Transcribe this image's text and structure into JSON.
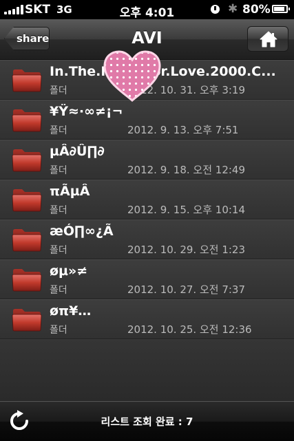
{
  "status_bar": {
    "carrier": "SKT",
    "network": "3G",
    "time": "오후 4:01",
    "battery": "80%"
  },
  "nav": {
    "back_label": "share",
    "title": "AVI",
    "home_icon": "home-icon"
  },
  "items": [
    {
      "name": "In.The.Mood.for.Love.2000.C...",
      "kind": "폴더",
      "date": "2012. 10. 31. 오후 3:19",
      "icon": "folder-icon"
    },
    {
      "name": "¥Ÿ≈·∞≠¡¬",
      "kind": "폴더",
      "date": "2012. 9. 13. 오후 7:51",
      "icon": "folder-icon"
    },
    {
      "name": "µÂ∂Û∏∂",
      "kind": "폴더",
      "date": "2012. 9. 18. 오전 12:49",
      "icon": "folder-icon"
    },
    {
      "name": "πÃµÂ",
      "kind": "폴더",
      "date": "2012. 9. 15. 오후 10:14",
      "icon": "folder-icon"
    },
    {
      "name": "æÓ∏∞¿Ã",
      "kind": "폴더",
      "date": "2012. 10. 29. 오전 1:23",
      "icon": "folder-icon"
    },
    {
      "name": "øµ»≠",
      "kind": "폴더",
      "date": "2012. 10. 27. 오전 7:37",
      "icon": "folder-icon"
    },
    {
      "name": "øπ¥…",
      "kind": "폴더",
      "date": "2012. 10. 25. 오전 12:36",
      "icon": "folder-icon"
    }
  ],
  "toolbar": {
    "refresh_icon": "refresh-icon",
    "status": "리스트 조회 완료 : 7"
  },
  "colors": {
    "folder": "#c0392b",
    "heart": "#e07aa8"
  }
}
